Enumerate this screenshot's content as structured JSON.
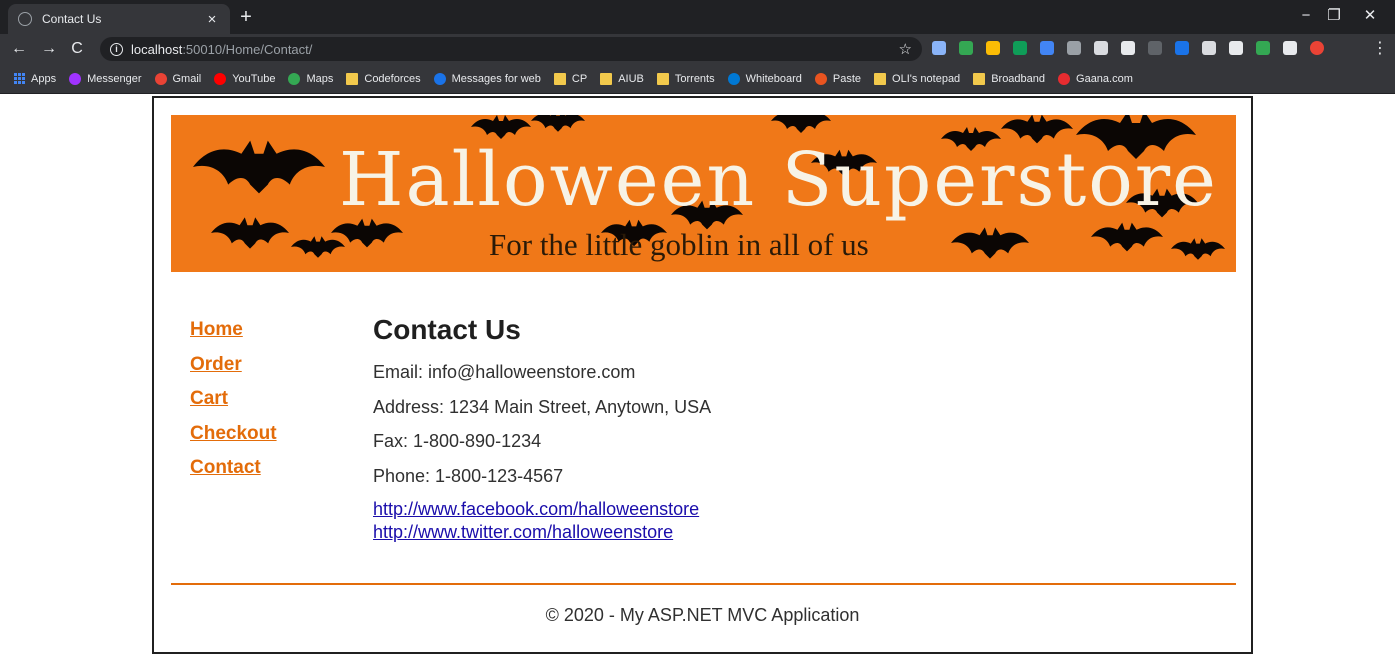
{
  "browser": {
    "tab_title": "Contact Us",
    "tab_close": "×",
    "new_tab": "+",
    "url_host": "localhost",
    "url_rest": ":50010/Home/Contact/",
    "nav": {
      "back": "←",
      "forward": "→",
      "reload": "C"
    },
    "window": {
      "minimize": "−",
      "restore": "❐",
      "close": "✕"
    },
    "star": "☆",
    "menu": "⋮",
    "extension_colors": [
      "#8ab4f8",
      "#34a853",
      "#fbbc05",
      "#0f9d58",
      "#4285f4",
      "#9aa0a6",
      "#dadce0",
      "#e8eaed",
      "#5f6368",
      "#1a73e8",
      "#dadce0",
      "#e8eaed",
      "#34a853",
      "#e8eaed",
      "#ea4335"
    ],
    "bookmarks": [
      {
        "label": "Apps",
        "icon": "apps-grid-icon"
      },
      {
        "label": "Messenger",
        "icon": "messenger-icon",
        "color": "#a033ff"
      },
      {
        "label": "Gmail",
        "icon": "gmail-icon",
        "color": "#ea4335"
      },
      {
        "label": "YouTube",
        "icon": "youtube-icon",
        "color": "#ff0000"
      },
      {
        "label": "Maps",
        "icon": "maps-icon",
        "color": "#34a853"
      },
      {
        "label": "Codeforces",
        "icon": "folder-icon",
        "color": "#f2c94c"
      },
      {
        "label": "Messages for web",
        "icon": "messages-icon",
        "color": "#1a73e8"
      },
      {
        "label": "CP",
        "icon": "folder-icon",
        "color": "#f2c94c"
      },
      {
        "label": "AIUB",
        "icon": "folder-icon",
        "color": "#f2c94c"
      },
      {
        "label": "Torrents",
        "icon": "folder-icon",
        "color": "#f2c94c"
      },
      {
        "label": "Whiteboard",
        "icon": "whiteboard-icon",
        "color": "#0078d4"
      },
      {
        "label": "Paste",
        "icon": "ubuntu-icon",
        "color": "#e95420"
      },
      {
        "label": "OLI's notepad",
        "icon": "folder-icon",
        "color": "#f2c94c"
      },
      {
        "label": "Broadband",
        "icon": "folder-icon",
        "color": "#f2c94c"
      },
      {
        "label": "Gaana.com",
        "icon": "gaana-icon",
        "color": "#e72c30"
      }
    ]
  },
  "banner": {
    "title": "Halloween Superstore",
    "tagline": "For the little goblin in all of us",
    "color": "#f07818"
  },
  "nav": [
    {
      "label": "Home"
    },
    {
      "label": "Order"
    },
    {
      "label": "Cart"
    },
    {
      "label": "Checkout"
    },
    {
      "label": "Contact"
    }
  ],
  "contact": {
    "heading": "Contact Us",
    "email": "Email: info@halloweenstore.com",
    "address": "Address: 1234 Main Street, Anytown, USA",
    "fax": "Fax: 1-800-890-1234",
    "phone": "Phone: 1-800-123-4567",
    "facebook": "http://www.facebook.com/halloweenstore",
    "twitter": "http://www.twitter.com/halloweenstore"
  },
  "footer": {
    "text": "© 2020 - My ASP.NET MVC Application"
  },
  "colors": {
    "accent": "#e36c0a",
    "link": "#1a0dab"
  }
}
